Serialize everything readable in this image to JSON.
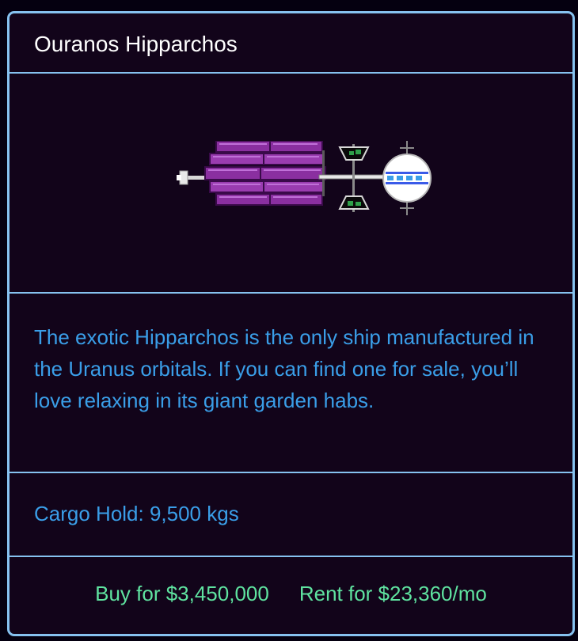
{
  "ship": {
    "name": "Ouranos Hipparchos",
    "image_icon": "ship-sprite-icon",
    "description": "The exotic Hipparchos is the only ship manufactured in the Uranus orbitals. If you can find one for sale, you’ll love relaxing in its giant garden habs.",
    "cargo": "Cargo Hold: 9,500 kgs",
    "buy": "Buy for $3,450,000",
    "rent": "Rent for $23,360/mo"
  },
  "colors": {
    "border": "#86c2f0",
    "background": "#12041a",
    "title_text": "#ffffff",
    "body_text": "#3a9ee8",
    "price_text": "#5fe3a0",
    "hull_purple": "#8a2fa0"
  }
}
